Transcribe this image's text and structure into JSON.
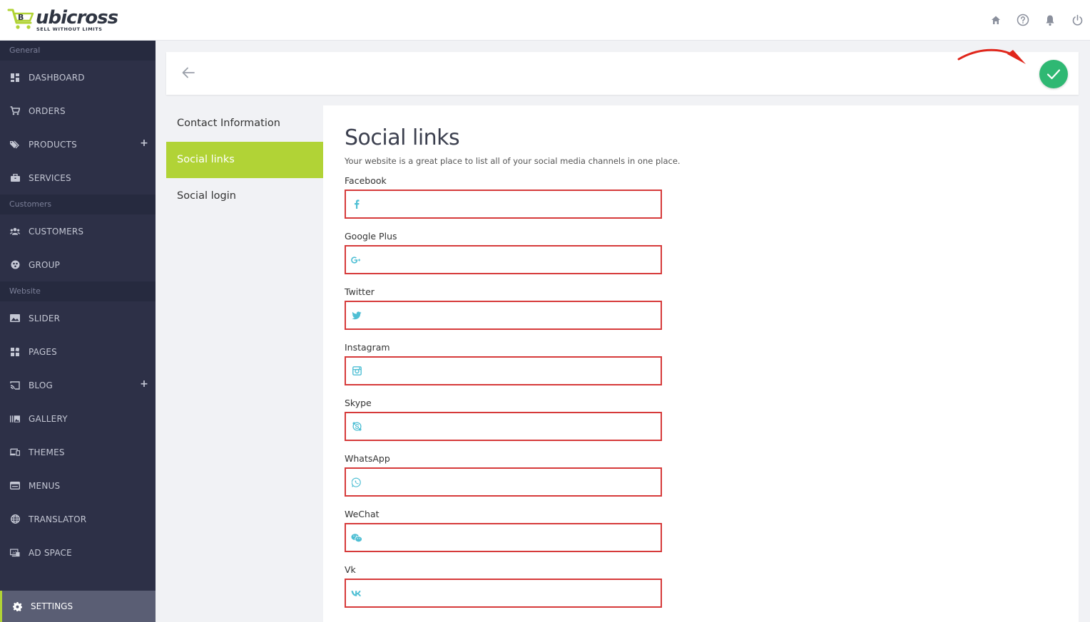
{
  "brand": {
    "name": "ubicross",
    "tagline": "SELL WITHOUT LIMITS",
    "color": "#b1d336"
  },
  "topbar": {
    "icons": [
      "home-icon",
      "help-icon",
      "bell-icon",
      "power-icon"
    ]
  },
  "sidebar": {
    "sections": [
      {
        "title": "General",
        "items": [
          {
            "label": "DASHBOARD",
            "icon": "dashboard-icon"
          },
          {
            "label": "ORDERS",
            "icon": "cart-icon"
          },
          {
            "label": "PRODUCTS",
            "icon": "tags-icon",
            "expandable": true
          },
          {
            "label": "SERVICES",
            "icon": "briefcase-icon"
          }
        ]
      },
      {
        "title": "Customers",
        "items": [
          {
            "label": "CUSTOMERS",
            "icon": "users-icon"
          },
          {
            "label": "GROUP",
            "icon": "group-icon"
          }
        ]
      },
      {
        "title": "Website",
        "items": [
          {
            "label": "SLIDER",
            "icon": "image-icon"
          },
          {
            "label": "PAGES",
            "icon": "pages-icon"
          },
          {
            "label": "BLOG",
            "icon": "cast-icon",
            "expandable": true
          },
          {
            "label": "GALLERY",
            "icon": "gallery-icon"
          },
          {
            "label": "THEMES",
            "icon": "devices-icon"
          },
          {
            "label": "MENUS",
            "icon": "menu-icon"
          },
          {
            "label": "TRANSLATOR",
            "icon": "globe-icon"
          },
          {
            "label": "AD SPACE",
            "icon": "ad-icon"
          }
        ]
      }
    ],
    "settings_label": "SETTINGS"
  },
  "tabs": [
    {
      "label": "Contact Information",
      "active": false
    },
    {
      "label": "Social links",
      "active": true
    },
    {
      "label": "Social login",
      "active": false
    }
  ],
  "content": {
    "title": "Social links",
    "description": "Your website is a great place to list all of your social media channels in one place.",
    "fields": [
      {
        "label": "Facebook",
        "icon": "facebook-icon",
        "value": "",
        "placeholder": ""
      },
      {
        "label": "Google Plus",
        "icon": "google-plus-icon",
        "value": "",
        "placeholder": ""
      },
      {
        "label": "Twitter",
        "icon": "twitter-icon",
        "value": "",
        "placeholder": ""
      },
      {
        "label": "Instagram",
        "icon": "instagram-icon",
        "value": "",
        "placeholder": ""
      },
      {
        "label": "Skype",
        "icon": "skype-icon",
        "value": "",
        "placeholder": ""
      },
      {
        "label": "WhatsApp",
        "icon": "whatsapp-icon",
        "value": "",
        "placeholder": ""
      },
      {
        "label": "WeChat",
        "icon": "wechat-icon",
        "value": "",
        "placeholder": ""
      },
      {
        "label": "Vk",
        "icon": "vk-icon",
        "value": "",
        "placeholder": ""
      }
    ]
  },
  "colors": {
    "sidebar_bg": "#2d3047",
    "accent": "#b1d336",
    "save": "#2fb873",
    "error_border": "#d63a3a",
    "field_icon": "#4fbfd4",
    "annotation_arrow": "#e0261b"
  }
}
